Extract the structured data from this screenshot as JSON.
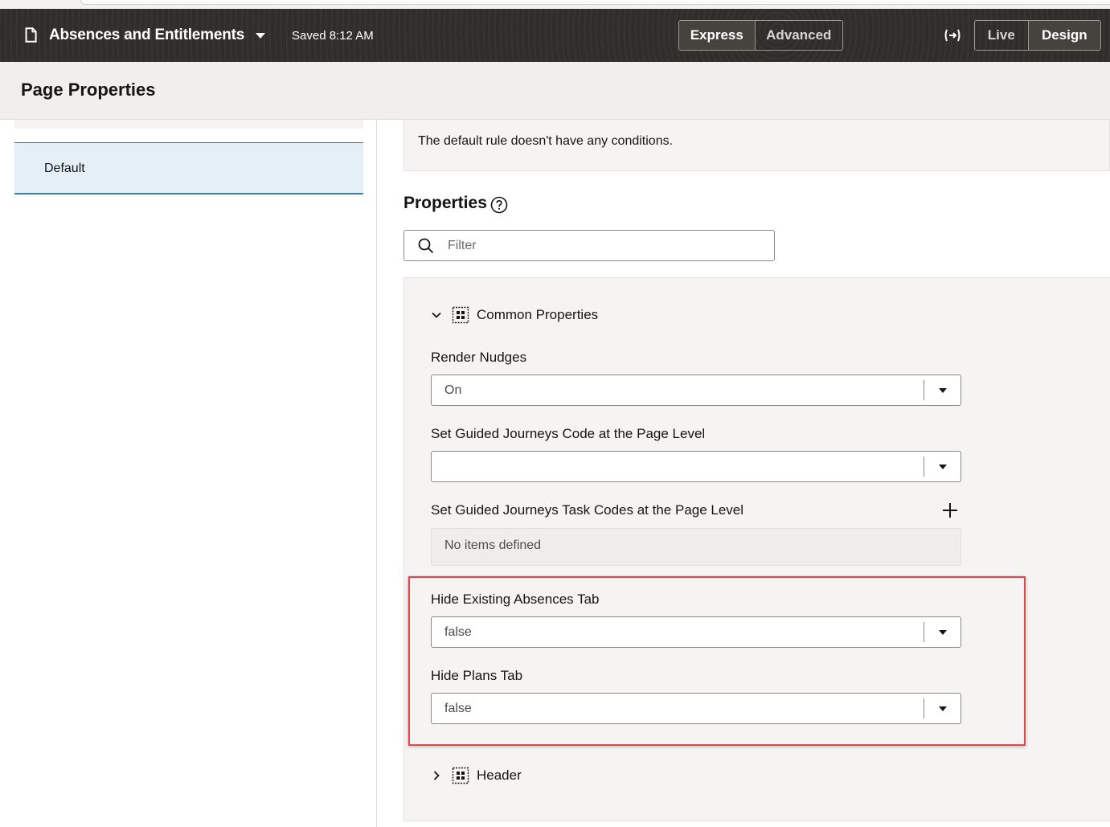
{
  "app": {
    "title": "Absences and Entitlements",
    "saved_status": "Saved 8:12 AM",
    "mode_toggle": {
      "options": [
        "Express",
        "Advanced"
      ],
      "selected": "Express"
    },
    "view_toggle": {
      "options": [
        "Live",
        "Design"
      ],
      "selected": "Design"
    }
  },
  "page_title": "Page Properties",
  "rules": {
    "selected_rule": "Default"
  },
  "condition_message": "The default rule doesn't have any conditions.",
  "properties": {
    "heading": "Properties",
    "filter_placeholder": "Filter",
    "sections": [
      {
        "label": "Common Properties",
        "expanded": true
      },
      {
        "label": "Header",
        "expanded": false
      }
    ],
    "fields": {
      "render_nudges": {
        "label": "Render Nudges",
        "value": "On"
      },
      "guided_journeys_code": {
        "label": "Set Guided Journeys Code at the Page Level",
        "value": ""
      },
      "guided_journeys_task_codes": {
        "label": "Set Guided Journeys Task Codes at the Page Level",
        "empty_text": "No items defined"
      },
      "hide_existing_absences_tab": {
        "label": "Hide Existing Absences Tab",
        "value": "false"
      },
      "hide_plans_tab": {
        "label": "Hide Plans Tab",
        "value": "false"
      }
    }
  },
  "colors": {
    "topbar_bg": "#312d2a",
    "selected_rule_bg": "#e4eff7",
    "selected_rule_border": "#3c7db0",
    "highlight_border": "#e0484e"
  },
  "icons": [
    "document-icon",
    "chevron-down-icon",
    "exit-preview-icon",
    "help-icon",
    "search-icon",
    "grid-icon",
    "chevron-right-icon",
    "plus-icon"
  ]
}
